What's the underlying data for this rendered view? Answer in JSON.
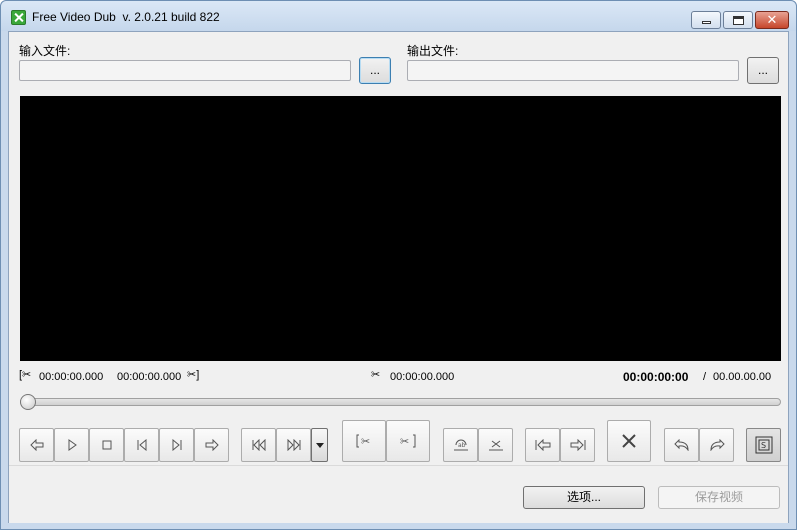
{
  "window": {
    "title": "Free Video Dub  v. 2.0.21 build 822",
    "minimize_icon": "minimize-icon",
    "maximize_icon": "maximize-icon",
    "close_icon": "close-icon",
    "close_glyph": "✕"
  },
  "input": {
    "label": "输入文件:",
    "value": "",
    "browse_label": "..."
  },
  "output": {
    "label": "输出文件:",
    "value": "",
    "browse_label": "..."
  },
  "timeline": {
    "start_time": "00:00:00.000",
    "end_time": "00:00:00.000",
    "cursor_time": "00:00:00.000",
    "current_time": "00:00:00:00",
    "separator": "/",
    "total_time": "00.00.00.00",
    "seek_value": 0
  },
  "toolbar": {
    "icons": [
      "step-back-icon",
      "play-icon",
      "stop-icon",
      "prev-frame-icon",
      "next-frame-icon",
      "step-forward-icon",
      "prev-keyframe-icon",
      "next-keyframe-icon",
      "dropdown-arrow-icon",
      "cut-start-icon",
      "cut-end-icon",
      "select-segment-icon",
      "clear-selection-icon",
      "go-start-icon",
      "go-end-icon",
      "delete-icon",
      "undo-icon",
      "redo-icon",
      "screenshot-icon"
    ]
  },
  "footer": {
    "options_label": "选项...",
    "save_label": "保存视频"
  },
  "colors": {
    "video_bg": "#000000",
    "window_bg": "#f0f0f0",
    "disabled_text": "#9c9c9c"
  }
}
